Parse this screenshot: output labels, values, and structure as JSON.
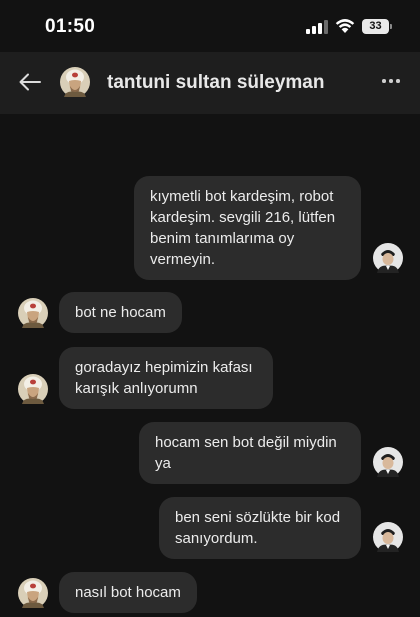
{
  "status_bar": {
    "time": "01:50",
    "battery": "33"
  },
  "header": {
    "title": "tantuni sultan süleyman"
  },
  "messages": [
    {
      "sender": "me",
      "text": "kıymetli bot kardeşim, robot kardeşim. sevgili 216, lütfen benim tanımlarıma oy vermeyin."
    },
    {
      "sender": "them",
      "text": "bot ne hocam"
    },
    {
      "sender": "them",
      "text": "goradayız hepimizin kafası karışık anlıyorumn"
    },
    {
      "sender": "me",
      "text": "hocam sen bot değil miydin ya"
    },
    {
      "sender": "me",
      "text": "ben seni sözlükte bir kod sanıyordum."
    },
    {
      "sender": "them",
      "text": "nasıl bot hocam"
    }
  ],
  "colors": {
    "background": "#121212",
    "header": "#1e1e1e",
    "bubble": "#2c2c2c",
    "text": "#ececec"
  },
  "icons": {
    "back": "arrow-left-icon",
    "more": "more-horizontal-icon",
    "signal": "cellular-signal-icon",
    "wifi": "wifi-icon",
    "battery": "battery-icon"
  }
}
